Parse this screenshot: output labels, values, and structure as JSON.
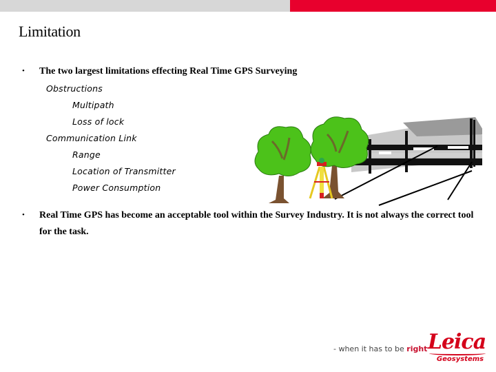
{
  "header": {
    "bar_colors": {
      "left": "#d7d7d7",
      "right": "#e8002d"
    }
  },
  "slide": {
    "title": "Limitation",
    "bullets": [
      {
        "symbol": "•",
        "text": "The two largest limitations effecting Real Time GPS Surveying",
        "children": [
          {
            "text": "Obstructions",
            "children": [
              {
                "text": "Multipath"
              },
              {
                "text": "Loss of lock"
              }
            ]
          },
          {
            "text": "Communication Link",
            "children": [
              {
                "text": "Range"
              },
              {
                "text": "Location of Transmitter"
              },
              {
                "text": "Power Consumption"
              }
            ]
          }
        ]
      },
      {
        "symbol": "•",
        "text_line1": "Real Time GPS has become an acceptable tool within the Survey Industry. It is not always the correct tool",
        "text_line2": "for the task."
      }
    ]
  },
  "illustration": {
    "elements": [
      "tree",
      "tree",
      "gps-tripod",
      "building",
      "signal-lines"
    ]
  },
  "footer": {
    "tagline_prefix": "- when it has to be ",
    "tagline_emphasis": "right",
    "logo_word": "Leica",
    "logo_sub": "Geosystems",
    "brand_color": "#d4001a"
  }
}
